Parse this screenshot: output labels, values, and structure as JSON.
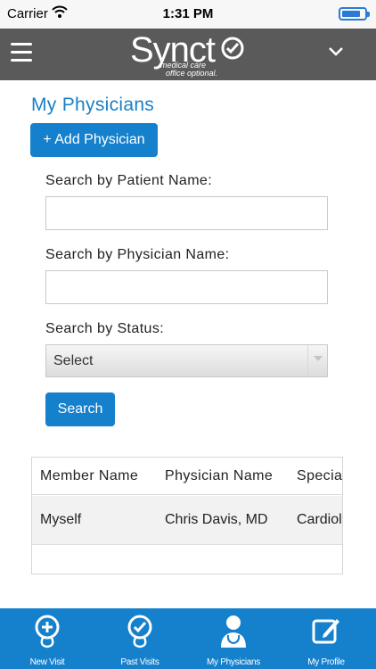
{
  "status_bar": {
    "carrier": "Carrier",
    "time": "1:31 PM"
  },
  "header": {
    "logo_word": "Synct",
    "tagline_line1": "medical care",
    "tagline_line2": "office optional."
  },
  "page": {
    "title": "My Physicians",
    "add_button": "+ Add Physician",
    "search_patient_label": "Search by Patient Name:",
    "search_patient_value": "",
    "search_physician_label": "Search by Physician Name:",
    "search_physician_value": "",
    "search_status_label": "Search by Status:",
    "status_selected": "Select",
    "search_button": "Search"
  },
  "table": {
    "headers": [
      "Member Name",
      "Physician Name",
      "Specia"
    ],
    "rows": [
      [
        "Myself",
        "Chris Davis, MD",
        "Cardiol"
      ]
    ]
  },
  "tabbar": {
    "tabs": [
      {
        "label": "New Visit",
        "icon": "stethoscope-plus-icon"
      },
      {
        "label": "Past Visits",
        "icon": "stethoscope-clock-icon"
      },
      {
        "label": "My Physicians",
        "icon": "doctor-icon"
      },
      {
        "label": "My Profile",
        "icon": "edit-icon"
      }
    ]
  },
  "colors": {
    "accent": "#1580cc",
    "header_bg": "#5a5a5a",
    "title": "#1a7fc6"
  }
}
